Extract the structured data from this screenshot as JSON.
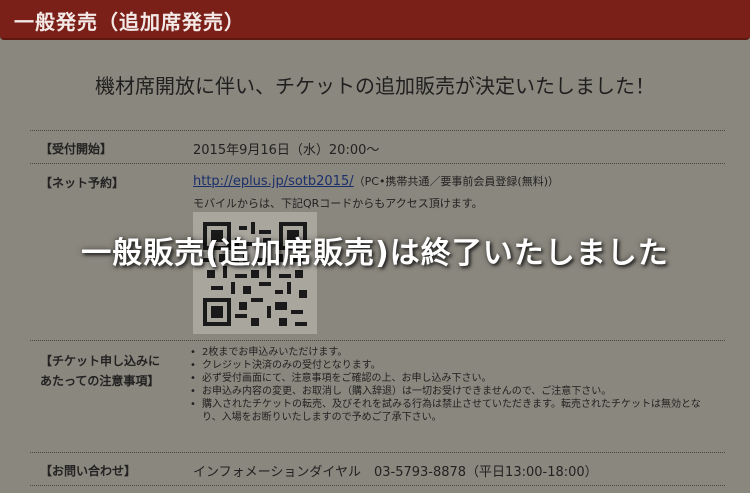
{
  "header": {
    "title": "一般発売（追加席発売）"
  },
  "announcement": "機材席開放に伴い、チケットの追加販売が決定いたしました！",
  "reception": {
    "label": "【受付開始】",
    "value": "2015年9月16日（水）20:00～"
  },
  "net": {
    "label": "【ネット予約】",
    "url": "http://eplus.jp/sotb2015/",
    "note": "（PC•携帯共通／要事前会員登録(無料)）",
    "mobile": "モバイルからは、下記QRコードからもアクセス頂けます。"
  },
  "notes": {
    "label_line1": "【チケット申し込みに",
    "label_line2": "あたっての注意事項】",
    "items": [
      "2枚までお申込みいただけます。",
      "クレジット決済のみの受付となります。",
      "必ず受付画面にて、注意事項をご確認の上、お申し込み下さい。",
      "お申込み内容の変更、お取消し（購入辞退）は一切お受けできませんので、ご注意下さい。",
      "購入されたチケットの転売、及びそれを試みる行為は禁止させていただきます。転売されたチケットは無効となり、入場をお断りいたしますので予めご了承下さい。"
    ]
  },
  "contact": {
    "label": "【お問い合わせ】",
    "value": "インフォメーションダイヤル　03-5793-8878（平日13:00-18:00）"
  },
  "overlay": "一般販売(追加席販売)は終了いたしました"
}
